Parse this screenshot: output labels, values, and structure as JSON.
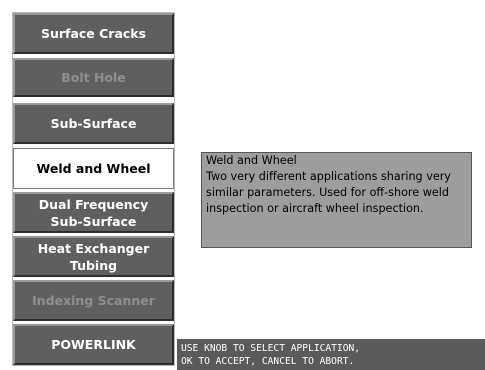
{
  "menu": {
    "items": [
      {
        "label": "Surface Cracks",
        "state": "enabled"
      },
      {
        "label": "Bolt Hole",
        "state": "disabled"
      },
      {
        "label": "Sub-Surface",
        "state": "enabled"
      },
      {
        "label": "Weld and Wheel",
        "state": "selected"
      },
      {
        "label": "Dual Frequency\nSub-Surface",
        "state": "enabled"
      },
      {
        "label": "Heat Exchanger\nTubing",
        "state": "enabled"
      },
      {
        "label": "Indexing Scanner",
        "state": "disabled"
      },
      {
        "label": "POWERLINK",
        "state": "enabled"
      }
    ]
  },
  "description": {
    "title": "Weld and Wheel",
    "body": "Two very different applications sharing very similar parameters. Used for off-shore weld inspection or aircraft wheel inspection."
  },
  "status": {
    "line1": "USE KNOB TO SELECT APPLICATION,",
    "line2": "OK TO ACCEPT, CANCEL TO ABORT."
  },
  "colors": {
    "button_bg": "#5f5f5f",
    "selected_bg": "#ffffff",
    "description_bg": "#9d9d9d",
    "status_bg": "#5a5a5a"
  }
}
